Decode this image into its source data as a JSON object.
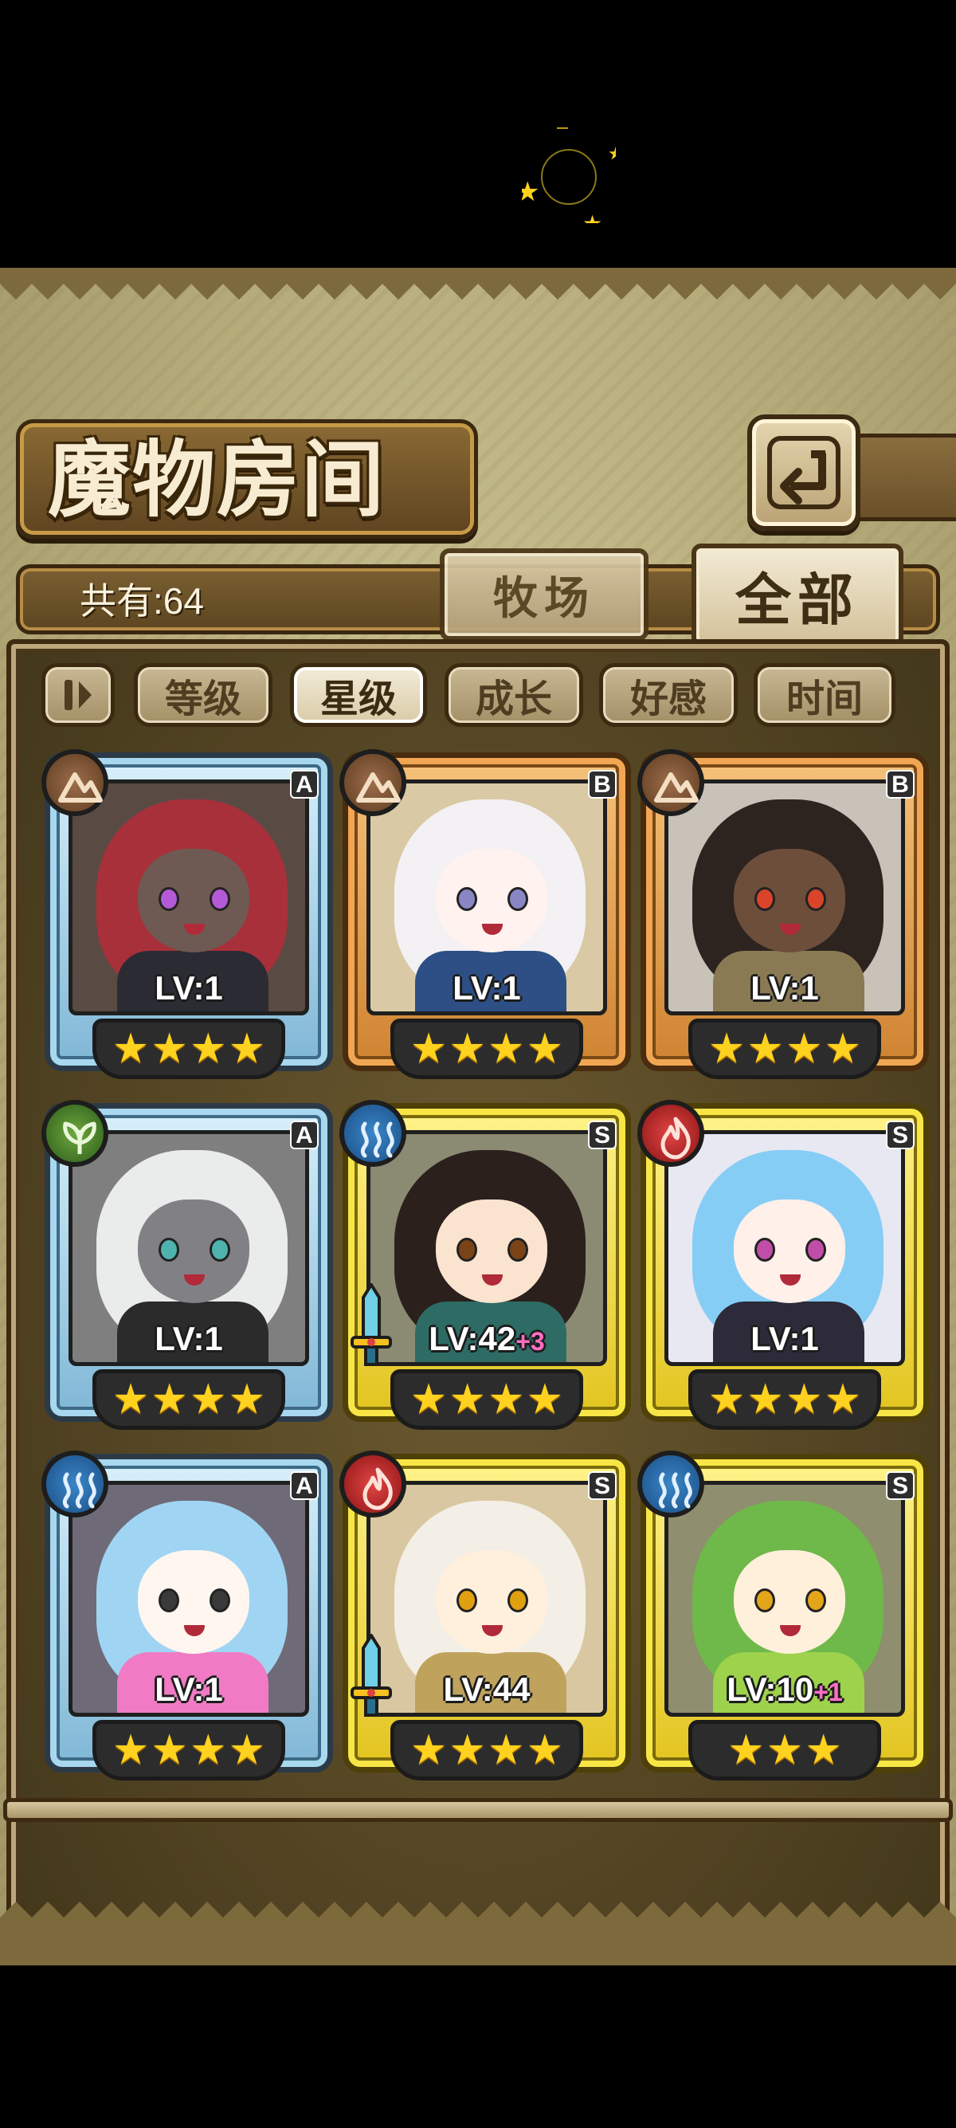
{
  "title": "魔物房间",
  "total_count": "共有:64",
  "tabs": [
    {
      "label": "牧场",
      "active": false
    },
    {
      "label": "全部",
      "active": true
    }
  ],
  "sort_buttons": [
    {
      "label": "等级",
      "active": false
    },
    {
      "label": "星级",
      "active": true
    },
    {
      "label": "成长",
      "active": false
    },
    {
      "label": "好感",
      "active": false
    },
    {
      "label": "时间",
      "active": false
    }
  ],
  "icons": {
    "back": "back-arrow-icon",
    "sort_toggle": "sort-order-icon",
    "loading": "loading-spinner-icon"
  },
  "colors": {
    "rank_A": "#7fb7d6",
    "rank_B": "#cf8331",
    "rank_S": "#e2c41f",
    "star": "#ffd21f",
    "plus": "#ff6fc4"
  },
  "monsters": [
    {
      "rank": "A",
      "element": "earth",
      "level": "LV:1",
      "plus": "",
      "stars": 4,
      "weapon": false
    },
    {
      "rank": "B",
      "element": "earth",
      "level": "LV:1",
      "plus": "",
      "stars": 4,
      "weapon": false
    },
    {
      "rank": "B",
      "element": "earth",
      "level": "LV:1",
      "plus": "",
      "stars": 4,
      "weapon": false
    },
    {
      "rank": "A",
      "element": "plant",
      "level": "LV:1",
      "plus": "",
      "stars": 4,
      "weapon": false
    },
    {
      "rank": "S",
      "element": "water",
      "level": "LV:42",
      "plus": "+3",
      "stars": 4,
      "weapon": true
    },
    {
      "rank": "S",
      "element": "fire",
      "level": "LV:1",
      "plus": "",
      "stars": 4,
      "weapon": false
    },
    {
      "rank": "A",
      "element": "water",
      "level": "LV:1",
      "plus": "",
      "stars": 4,
      "weapon": false
    },
    {
      "rank": "S",
      "element": "fire",
      "level": "LV:44",
      "plus": "",
      "stars": 4,
      "weapon": true
    },
    {
      "rank": "S",
      "element": "water",
      "level": "LV:10",
      "plus": "+1",
      "stars": 3,
      "weapon": false
    }
  ]
}
